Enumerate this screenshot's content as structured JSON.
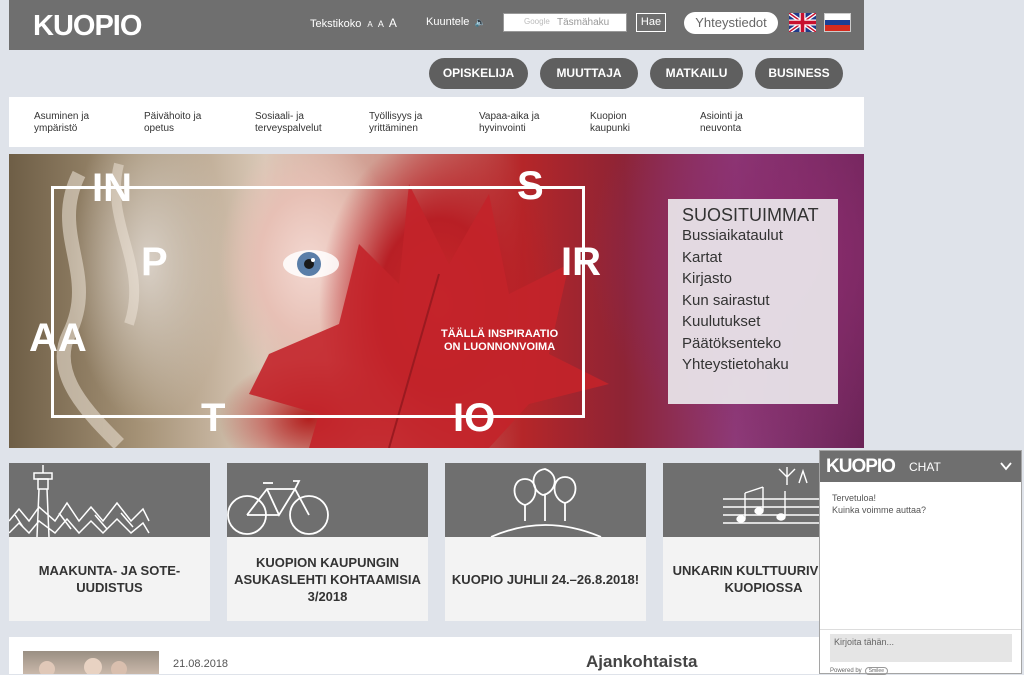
{
  "header": {
    "logo": "KUOPIO",
    "text_size_label": "Tekstikoko",
    "text_size_options": [
      "A",
      "A",
      "A"
    ],
    "listen_label": "Kuuntele",
    "search_google": "Google",
    "search_placeholder": "Täsmähaku",
    "search_button": "Hae",
    "contacts_button": "Yhteystiedot",
    "flags": [
      "uk-flag-icon",
      "ru-flag-icon"
    ]
  },
  "audience_buttons": [
    "OPISKELIJA",
    "MUUTTAJA",
    "MATKAILU",
    "BUSINESS"
  ],
  "menu": [
    {
      "line1": "Asuminen ja",
      "line2": "ympäristö"
    },
    {
      "line1": "Päivähoito ja",
      "line2": "opetus"
    },
    {
      "line1": "Sosiaali- ja",
      "line2": "terveyspalvelut"
    },
    {
      "line1": "Työllisyys ja",
      "line2": "yrittäminen"
    },
    {
      "line1": "Vapaa-aika ja",
      "line2": "hyvinvointi"
    },
    {
      "line1": "Kuopion",
      "line2": "kaupunki"
    },
    {
      "line1": "Asiointi ja",
      "line2": "neuvonta"
    }
  ],
  "hero": {
    "letters": [
      "IN",
      "S",
      "P",
      "IR",
      "AA",
      "T",
      "IO"
    ],
    "slogan_line1": "TÄÄLLÄ INSPIRAATIO",
    "slogan_line2": "ON LUONNONVOIMA",
    "popular_title": "SUOSITUIMMAT",
    "popular_links": [
      "Bussiaikataulut",
      "Kartat",
      "Kirjasto",
      "Kun sairastut",
      "Kuulutukset",
      "Päätöksenteko",
      "Yhteystietohaku"
    ]
  },
  "cards": [
    {
      "title": "MAAKUNTA- JA SOTE-UUDISTUS",
      "icon": "city-skyline-icon"
    },
    {
      "title": "KUOPION KAUPUNGIN ASUKASLEHTI KOHTAAMISIA 3/2018",
      "icon": "bicycle-icon"
    },
    {
      "title": "KUOPIO JUHLII 24.–26.8.2018!",
      "icon": "trees-icon"
    },
    {
      "title": "UNKARIN KULTTUURIVIIKKO KUOPIOSSA",
      "icon": "music-notes-icon"
    }
  ],
  "news": {
    "date": "21.08.2018",
    "heading": "Ajankohtaista"
  },
  "chat": {
    "logo": "KUOPIO",
    "title": "CHAT",
    "greeting_line1": "Tervetuloa!",
    "greeting_line2": "Kuinka voimme auttaa?",
    "input_placeholder": "Kirjoita tähän...",
    "powered_by": "Powered by",
    "powered_badge": "Smilee"
  },
  "colors": {
    "header_gray": "#6f6f6f",
    "pill_gray": "#5f5f5f",
    "page_bg": "#dfe3ea"
  }
}
